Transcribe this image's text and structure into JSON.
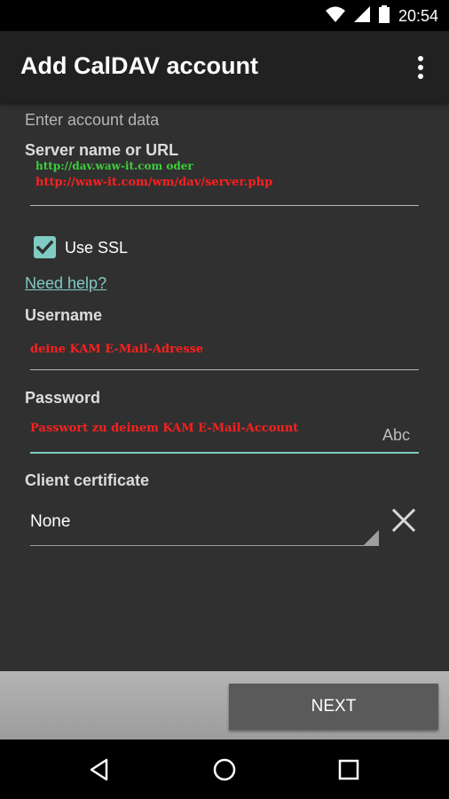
{
  "status_bar": {
    "time": "20:54"
  },
  "app_bar": {
    "title": "Add CalDAV account"
  },
  "form": {
    "section_header": "Enter account data",
    "server": {
      "label": "Server name or URL",
      "annotation_line1": "http://dav.waw-it.com oder",
      "annotation_line2": "http://waw-it.com/wm/dav/server.php"
    },
    "use_ssl": {
      "label": "Use SSL",
      "checked": true
    },
    "help_link": "Need help?",
    "username": {
      "label": "Username",
      "annotation": "deine KAM E-Mail-Adresse"
    },
    "password": {
      "label": "Password",
      "annotation": "Passwort zu deinem KAM E-Mail-Account",
      "input_type_hint": "Abc"
    },
    "client_certificate": {
      "label": "Client certificate",
      "selected": "None"
    }
  },
  "actions": {
    "next_label": "NEXT"
  },
  "colors": {
    "accent": "#80cbc4",
    "annotation_green": "#3ccf3c",
    "annotation_red": "#ff1f1f",
    "background": "#303030",
    "app_bar": "#212121"
  }
}
